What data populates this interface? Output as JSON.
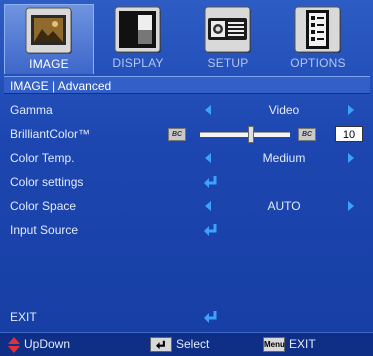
{
  "tabs": [
    {
      "label": "IMAGE",
      "icon": "image-icon",
      "active": true
    },
    {
      "label": "DISPLAY",
      "icon": "display-icon",
      "active": false
    },
    {
      "label": "SETUP",
      "icon": "setup-icon",
      "active": false
    },
    {
      "label": "OPTIONS",
      "icon": "options-icon",
      "active": false
    }
  ],
  "breadcrumb": "IMAGE  |  Advanced",
  "rows": {
    "gamma": {
      "label": "Gamma",
      "value": "Video"
    },
    "brilliantcolor": {
      "label": "BrilliantColor™",
      "value": "10",
      "level_fraction": 0.55,
      "icon_text": "BC"
    },
    "color_temp": {
      "label": "Color Temp.",
      "value": "Medium"
    },
    "color_settings": {
      "label": "Color settings"
    },
    "color_space": {
      "label": "Color Space",
      "value": "AUTO"
    },
    "input_source": {
      "label": "Input Source"
    },
    "exit": {
      "label": "EXIT"
    }
  },
  "footer": {
    "updown": "UpDown",
    "select": "Select",
    "exit": "EXIT",
    "menu_key": "Menu"
  },
  "colors": {
    "background": "#1a3fa6",
    "accent_arrow": "#3ea1ff",
    "active_tab": "#4f78d6"
  }
}
